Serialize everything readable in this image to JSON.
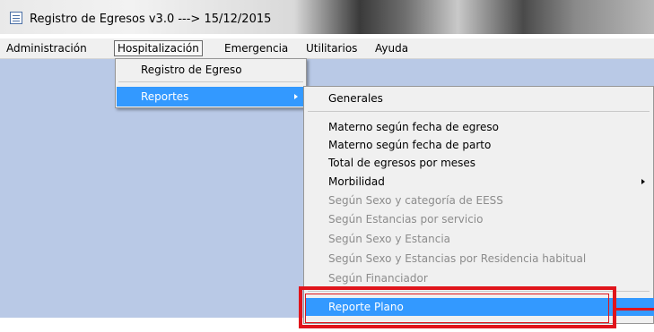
{
  "window": {
    "title": "Registro de Egresos v3.0  ---> 15/12/2015"
  },
  "menubar": {
    "items": [
      "Administración",
      "Hospitalización",
      "Emergencia",
      "Utilitarios",
      "Ayuda"
    ]
  },
  "hospitalizacion_menu": {
    "items": [
      "Registro de Egreso",
      "Reportes"
    ]
  },
  "reportes_submenu": {
    "items": [
      "Generales",
      "Materno según fecha de egreso",
      "Materno según fecha de parto",
      "Total de egresos por meses",
      "Morbilidad",
      "Según Sexo y categoría de EESS",
      "Según Estancias por servicio",
      "Según Sexo y Estancia",
      "Según Sexo y Estancias por Residencia habitual",
      "Según Financiador",
      "Reporte Plano"
    ]
  },
  "colors": {
    "highlight": "#3399ff",
    "annotation": "#e0141b",
    "workspace": "#b9c9e6",
    "disabled_text": "#8c8c8c"
  }
}
